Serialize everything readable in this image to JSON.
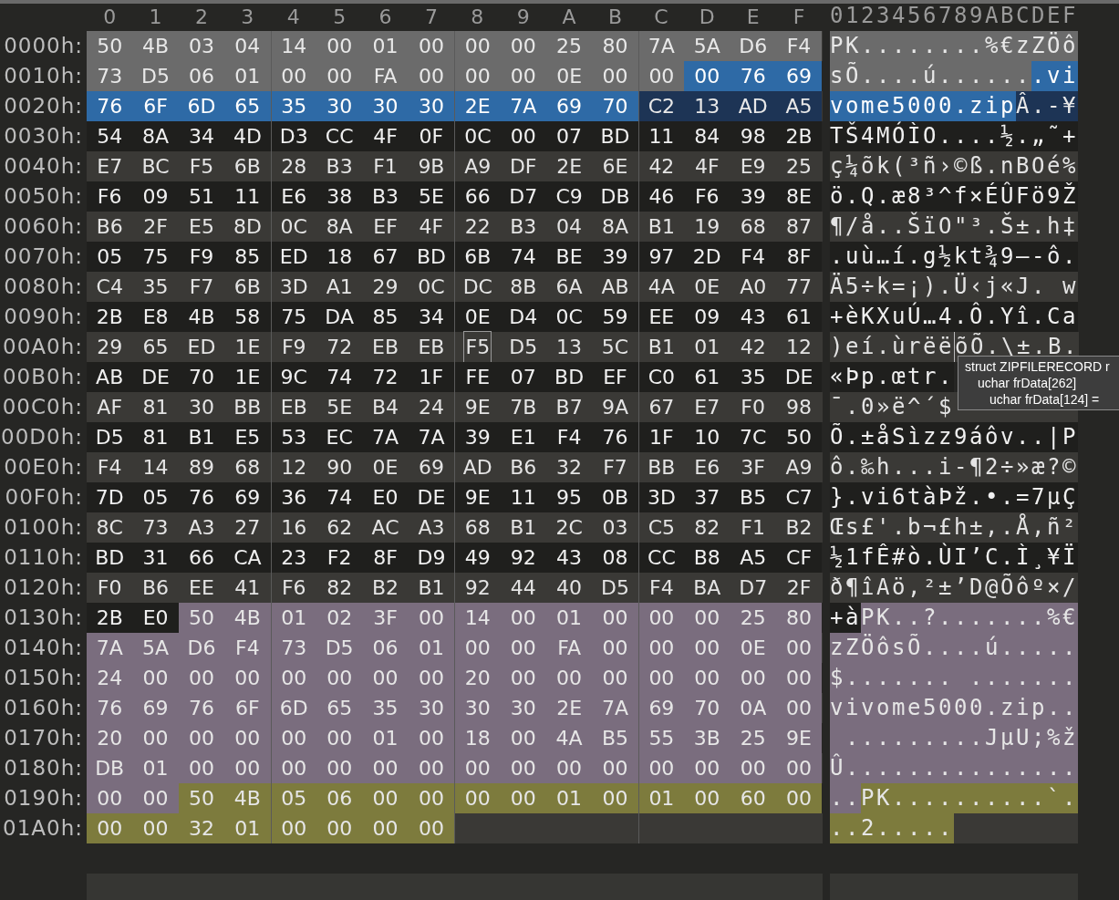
{
  "columns": [
    "0",
    "1",
    "2",
    "3",
    "4",
    "5",
    "6",
    "7",
    "8",
    "9",
    "A",
    "B",
    "C",
    "D",
    "E",
    "F"
  ],
  "ascii_header": "0123456789ABCDEF",
  "rows": [
    {
      "offset": "0000h:",
      "segments": [
        {
          "kind": "header",
          "bytes": [
            "50",
            "4B",
            "03",
            "04",
            "14",
            "00",
            "01",
            "00",
            "00",
            "00",
            "25",
            "80",
            "7A",
            "5A",
            "D6",
            "F4"
          ],
          "ascii": "PK........%€zZÖô"
        }
      ]
    },
    {
      "offset": "0010h:",
      "segments": [
        {
          "kind": "header",
          "bytes": [
            "73",
            "D5",
            "06",
            "01",
            "00",
            "00",
            "FA",
            "00",
            "00",
            "00",
            "0E",
            "00",
            "00"
          ],
          "ascii": "sÕ....ú......"
        },
        {
          "kind": "filename",
          "bytes": [
            "00",
            "76",
            "69"
          ],
          "ascii": ".vi"
        }
      ]
    },
    {
      "offset": "0020h:",
      "segments": [
        {
          "kind": "filename",
          "bytes": [
            "76",
            "6F",
            "6D",
            "65",
            "35",
            "30",
            "30",
            "30",
            "2E",
            "7A",
            "69",
            "70"
          ],
          "ascii": "vome5000.zip"
        },
        {
          "kind": "data_hover",
          "bytes": [
            "C2",
            "13",
            "AD",
            "A5"
          ],
          "ascii": "Â.-¥"
        }
      ]
    },
    {
      "offset": "0030h:",
      "segments": [
        {
          "kind": "data",
          "bytes": [
            "54",
            "8A",
            "34",
            "4D",
            "D3",
            "CC",
            "4F",
            "0F",
            "0C",
            "00",
            "07",
            "BD",
            "11",
            "84",
            "98",
            "2B"
          ],
          "ascii": "TŠ4MÓÌO....½.„˜+"
        }
      ]
    },
    {
      "offset": "0040h:",
      "segments": [
        {
          "kind": "data",
          "bytes": [
            "E7",
            "BC",
            "F5",
            "6B",
            "28",
            "B3",
            "F1",
            "9B",
            "A9",
            "DF",
            "2E",
            "6E",
            "42",
            "4F",
            "E9",
            "25"
          ],
          "ascii": "ç¼õk(³ñ›©ß.nBOé%"
        }
      ]
    },
    {
      "offset": "0050h:",
      "segments": [
        {
          "kind": "data",
          "bytes": [
            "F6",
            "09",
            "51",
            "11",
            "E6",
            "38",
            "B3",
            "5E",
            "66",
            "D7",
            "C9",
            "DB",
            "46",
            "F6",
            "39",
            "8E"
          ],
          "ascii": "ö.Q.æ8³^f×ÉÛFö9Ž"
        }
      ]
    },
    {
      "offset": "0060h:",
      "segments": [
        {
          "kind": "data",
          "bytes": [
            "B6",
            "2F",
            "E5",
            "8D",
            "0C",
            "8A",
            "EF",
            "4F",
            "22",
            "B3",
            "04",
            "8A",
            "B1",
            "19",
            "68",
            "87"
          ],
          "ascii": "¶/å..ŠïO\"³.Š±.h‡"
        }
      ]
    },
    {
      "offset": "0070h:",
      "segments": [
        {
          "kind": "data",
          "bytes": [
            "05",
            "75",
            "F9",
            "85",
            "ED",
            "18",
            "67",
            "BD",
            "6B",
            "74",
            "BE",
            "39",
            "97",
            "2D",
            "F4",
            "8F"
          ],
          "ascii": ".uù…í.g½kt¾9—-ô."
        }
      ]
    },
    {
      "offset": "0080h:",
      "segments": [
        {
          "kind": "data",
          "bytes": [
            "C4",
            "35",
            "F7",
            "6B",
            "3D",
            "A1",
            "29",
            "0C",
            "DC",
            "8B",
            "6A",
            "AB",
            "4A",
            "0E",
            "A0",
            "77"
          ],
          "ascii": "Ä5÷k=¡).Ü‹j«J. w"
        }
      ]
    },
    {
      "offset": "0090h:",
      "segments": [
        {
          "kind": "data",
          "bytes": [
            "2B",
            "E8",
            "4B",
            "58",
            "75",
            "DA",
            "85",
            "34",
            "0E",
            "D4",
            "0C",
            "59",
            "EE",
            "09",
            "43",
            "61"
          ],
          "ascii": "+èKXuÚ…4.Ô.Yî.Ca"
        }
      ]
    },
    {
      "offset": "00A0h:",
      "segments": [
        {
          "kind": "data",
          "bytes": [
            "29",
            "65",
            "ED",
            "1E",
            "F9",
            "72",
            "EB",
            "EB"
          ],
          "ascii": ")eí.ùrëë"
        },
        {
          "kind": "data",
          "cursor": true,
          "bytes": [
            "F5"
          ],
          "ascii": "õ"
        },
        {
          "kind": "data",
          "bytes": [
            "D5",
            "13",
            "5C",
            "B1",
            "01",
            "42",
            "12"
          ],
          "ascii": "Õ.\\±.B."
        }
      ]
    },
    {
      "offset": "00B0h:",
      "segments": [
        {
          "kind": "data",
          "bytes": [
            "AB",
            "DE",
            "70",
            "1E",
            "9C",
            "74",
            "72",
            "1F",
            "FE",
            "07",
            "BD",
            "EF",
            "C0",
            "61",
            "35",
            "DE"
          ],
          "ascii": "«Þp.œtr."
        }
      ]
    },
    {
      "offset": "00C0h:",
      "segments": [
        {
          "kind": "data",
          "bytes": [
            "AF",
            "81",
            "30",
            "BB",
            "EB",
            "5E",
            "B4",
            "24",
            "9E",
            "7B",
            "B7",
            "9A",
            "67",
            "E7",
            "F0",
            "98"
          ],
          "ascii": "¯.0»ë^´$"
        }
      ]
    },
    {
      "offset": "00D0h:",
      "segments": [
        {
          "kind": "data",
          "bytes": [
            "D5",
            "81",
            "B1",
            "E5",
            "53",
            "EC",
            "7A",
            "7A",
            "39",
            "E1",
            "F4",
            "76",
            "1F",
            "10",
            "7C",
            "50"
          ],
          "ascii": "Õ.±åSìzz9áôv..|P"
        }
      ]
    },
    {
      "offset": "00E0h:",
      "segments": [
        {
          "kind": "data",
          "bytes": [
            "F4",
            "14",
            "89",
            "68",
            "12",
            "90",
            "0E",
            "69",
            "AD",
            "B6",
            "32",
            "F7",
            "BB",
            "E6",
            "3F",
            "A9"
          ],
          "ascii": "ô.‰h...i-¶2÷»æ?©"
        }
      ]
    },
    {
      "offset": "00F0h:",
      "segments": [
        {
          "kind": "data",
          "bytes": [
            "7D",
            "05",
            "76",
            "69",
            "36",
            "74",
            "E0",
            "DE",
            "9E",
            "11",
            "95",
            "0B",
            "3D",
            "37",
            "B5",
            "C7"
          ],
          "ascii": "}.vi6tàÞž.•.=7µÇ"
        }
      ]
    },
    {
      "offset": "0100h:",
      "segments": [
        {
          "kind": "data",
          "bytes": [
            "8C",
            "73",
            "A3",
            "27",
            "16",
            "62",
            "AC",
            "A3",
            "68",
            "B1",
            "2C",
            "03",
            "C5",
            "82",
            "F1",
            "B2"
          ],
          "ascii": "Œs£'.b¬£h±,.Å‚ñ²"
        }
      ]
    },
    {
      "offset": "0110h:",
      "segments": [
        {
          "kind": "data",
          "bytes": [
            "BD",
            "31",
            "66",
            "CA",
            "23",
            "F2",
            "8F",
            "D9",
            "49",
            "92",
            "43",
            "08",
            "CC",
            "B8",
            "A5",
            "CF"
          ],
          "ascii": "½1fÊ#ò.ÙI’C.Ì¸¥Ï"
        }
      ]
    },
    {
      "offset": "0120h:",
      "segments": [
        {
          "kind": "data",
          "bytes": [
            "F0",
            "B6",
            "EE",
            "41",
            "F6",
            "82",
            "B2",
            "B1",
            "92",
            "44",
            "40",
            "D5",
            "F4",
            "BA",
            "D7",
            "2F"
          ],
          "ascii": "ð¶îAö‚²±’D@Õôº×/"
        }
      ]
    },
    {
      "offset": "0130h:",
      "segments": [
        {
          "kind": "data",
          "bytes": [
            "2B",
            "E0"
          ],
          "ascii": "+à"
        },
        {
          "kind": "central",
          "bytes": [
            "50",
            "4B",
            "01",
            "02",
            "3F",
            "00",
            "14",
            "00",
            "01",
            "00",
            "00",
            "00",
            "25",
            "80"
          ],
          "ascii": "PK..?.......%€"
        }
      ]
    },
    {
      "offset": "0140h:",
      "segments": [
        {
          "kind": "central",
          "bytes": [
            "7A",
            "5A",
            "D6",
            "F4",
            "73",
            "D5",
            "06",
            "01",
            "00",
            "00",
            "FA",
            "00",
            "00",
            "00",
            "0E",
            "00"
          ],
          "ascii": "zZÖôsÕ....ú....."
        }
      ]
    },
    {
      "offset": "0150h:",
      "segments": [
        {
          "kind": "central",
          "bytes": [
            "24",
            "00",
            "00",
            "00",
            "00",
            "00",
            "00",
            "00",
            "20",
            "00",
            "00",
            "00",
            "00",
            "00",
            "00",
            "00"
          ],
          "ascii": "$....... ......."
        }
      ]
    },
    {
      "offset": "0160h:",
      "segments": [
        {
          "kind": "central",
          "bytes": [
            "76",
            "69",
            "76",
            "6F",
            "6D",
            "65",
            "35",
            "30",
            "30",
            "30",
            "2E",
            "7A",
            "69",
            "70",
            "0A",
            "00"
          ],
          "ascii": "vivome5000.zip.."
        }
      ]
    },
    {
      "offset": "0170h:",
      "segments": [
        {
          "kind": "central",
          "bytes": [
            "20",
            "00",
            "00",
            "00",
            "00",
            "00",
            "01",
            "00",
            "18",
            "00",
            "4A",
            "B5",
            "55",
            "3B",
            "25",
            "9E"
          ],
          "ascii": " .........JµU;%ž"
        }
      ]
    },
    {
      "offset": "0180h:",
      "segments": [
        {
          "kind": "central",
          "bytes": [
            "DB",
            "01",
            "00",
            "00",
            "00",
            "00",
            "00",
            "00",
            "00",
            "00",
            "00",
            "00",
            "00",
            "00",
            "00",
            "00"
          ],
          "ascii": "Û..............."
        }
      ]
    },
    {
      "offset": "0190h:",
      "segments": [
        {
          "kind": "central",
          "bytes": [
            "00",
            "00"
          ],
          "ascii": ".."
        },
        {
          "kind": "end",
          "bytes": [
            "50",
            "4B",
            "05",
            "06",
            "00",
            "00",
            "00",
            "00",
            "01",
            "00",
            "01",
            "00",
            "60",
            "00"
          ],
          "ascii": "PK..........`."
        }
      ]
    },
    {
      "offset": "01A0h:",
      "segments": [
        {
          "kind": "end",
          "bytes": [
            "00",
            "00",
            "32",
            "01",
            "00",
            "00",
            "00",
            "00"
          ],
          "ascii": "..2....."
        }
      ]
    }
  ],
  "tooltip": {
    "lines": [
      "struct ZIPFILERECORD r",
      "uchar frData[262]",
      "uchar frData[124] ="
    ]
  }
}
